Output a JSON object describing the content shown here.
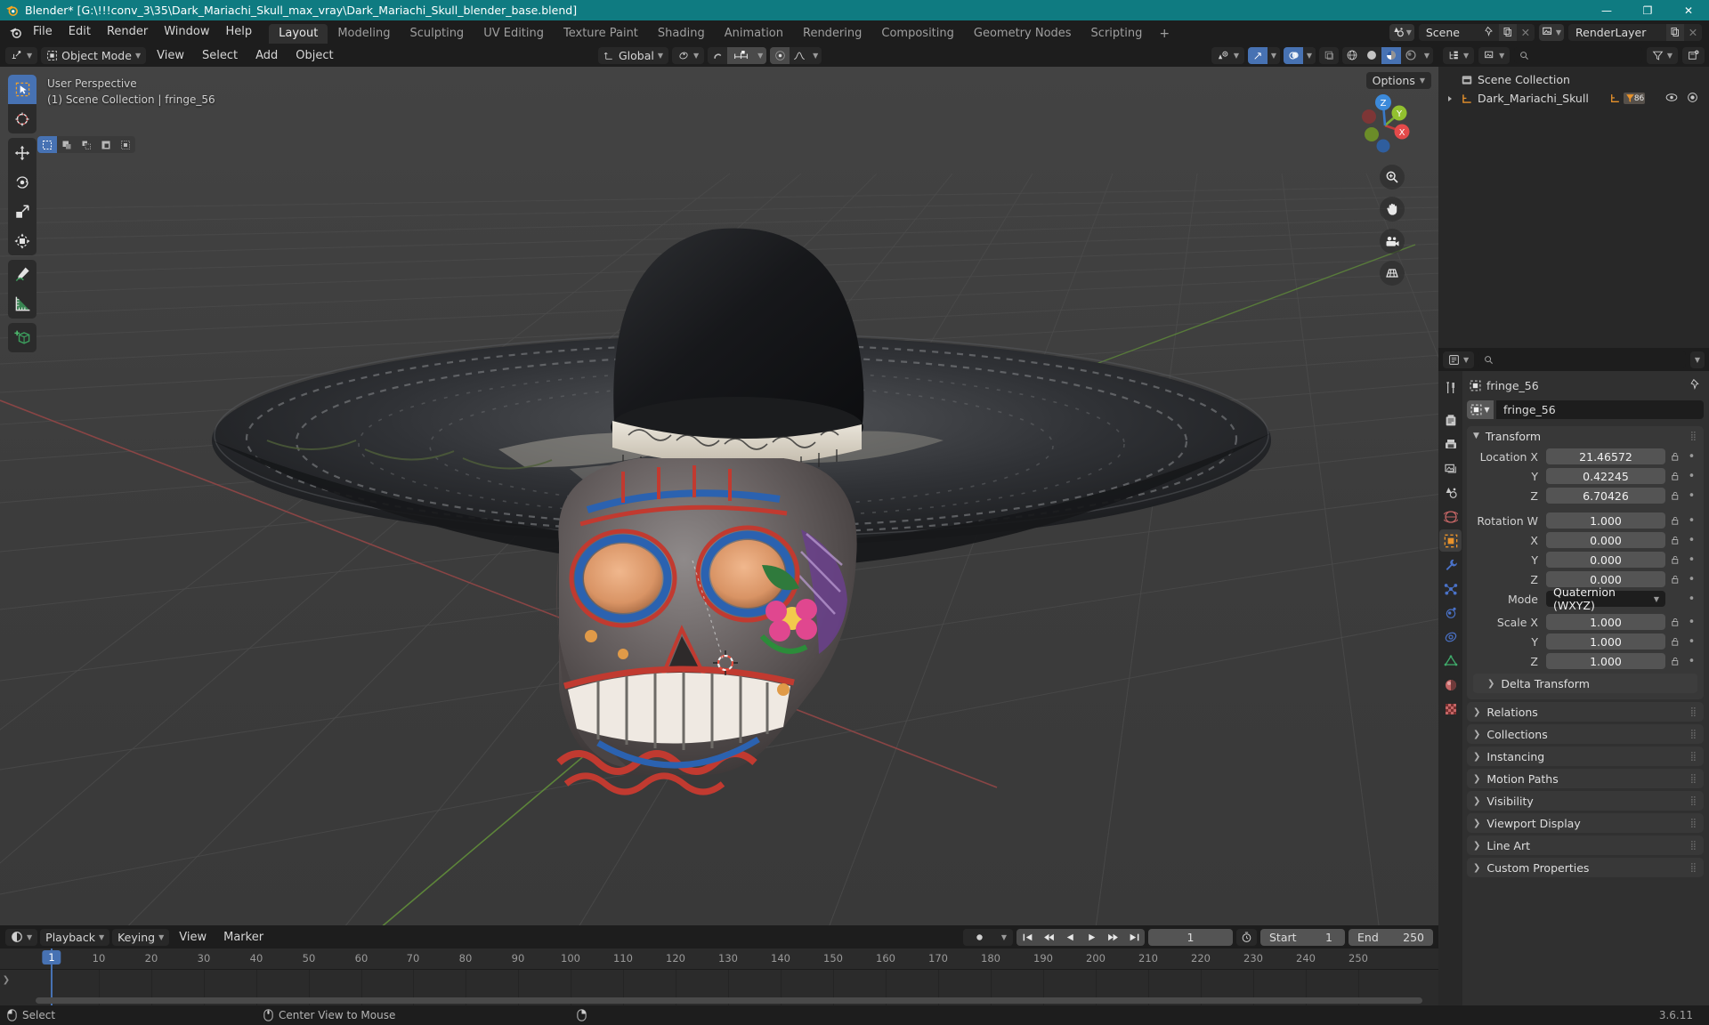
{
  "window": {
    "title": "Blender* [G:\\!!!conv_3\\35\\Dark_Mariachi_Skull_max_vray\\Dark_Mariachi_Skull_blender_base.blend]",
    "minimize": "—",
    "maximize": "❐",
    "close": "✕"
  },
  "topbar": {
    "menus": [
      "File",
      "Edit",
      "Render",
      "Window",
      "Help"
    ],
    "workspaces": [
      {
        "label": "Layout",
        "active": true
      },
      {
        "label": "Modeling",
        "active": false
      },
      {
        "label": "Sculpting",
        "active": false
      },
      {
        "label": "UV Editing",
        "active": false
      },
      {
        "label": "Texture Paint",
        "active": false
      },
      {
        "label": "Shading",
        "active": false
      },
      {
        "label": "Animation",
        "active": false
      },
      {
        "label": "Rendering",
        "active": false
      },
      {
        "label": "Compositing",
        "active": false
      },
      {
        "label": "Geometry Nodes",
        "active": false
      },
      {
        "label": "Scripting",
        "active": false
      }
    ],
    "add_workspace": "+",
    "scene_name": "Scene",
    "viewlayer_name": "RenderLayer"
  },
  "viewport_header": {
    "mode": "Object Mode",
    "menus": [
      "View",
      "Select",
      "Add",
      "Object"
    ],
    "transform_orientation": "Global",
    "options_label": "Options"
  },
  "viewport": {
    "perspective_text": "User Perspective",
    "collection_text": "(1) Scene Collection | fringe_56",
    "gizmo_axes": [
      "X",
      "Y",
      "Z"
    ],
    "tools": [
      "select-box-tool",
      "cursor-tool",
      "move-tool",
      "rotate-tool",
      "scale-tool",
      "transform-tool",
      "annotate-tool",
      "measure-tool",
      "add-cube-tool"
    ],
    "nav_buttons": [
      "zoom-icon",
      "pan-hand-icon",
      "camera-icon",
      "grid-ortho-icon"
    ]
  },
  "outliner": {
    "search_placeholder": "",
    "rows": [
      {
        "label": "Scene Collection",
        "level": 0,
        "icon": "collection-icon"
      },
      {
        "label": "Dark_Mariachi_Skull",
        "level": 1,
        "icon": "empty-axes-icon",
        "badge": "86"
      }
    ]
  },
  "properties": {
    "search_placeholder": "",
    "breadcrumb_object": "fringe_56",
    "object_name": "fringe_56",
    "tabs": [
      "tool-tab",
      "render-tab",
      "output-tab",
      "viewlayer-tab",
      "scene-tab",
      "world-tab",
      "object-tab",
      "modifier-tab",
      "particles-tab",
      "physics-tab",
      "constraints-tab",
      "data-tab",
      "material-tab",
      "texture-tab"
    ],
    "transform": {
      "title": "Transform",
      "location_label": "Location X",
      "location": [
        {
          "label": "Location X",
          "value": "21.46572"
        },
        {
          "label": "Y",
          "value": "0.42245"
        },
        {
          "label": "Z",
          "value": "6.70426"
        }
      ],
      "rotation": [
        {
          "label": "Rotation W",
          "value": "1.000"
        },
        {
          "label": "X",
          "value": "0.000"
        },
        {
          "label": "Y",
          "value": "0.000"
        },
        {
          "label": "Z",
          "value": "0.000"
        }
      ],
      "mode_label": "Mode",
      "mode_value": "Quaternion (WXYZ)",
      "scale": [
        {
          "label": "Scale X",
          "value": "1.000"
        },
        {
          "label": "Y",
          "value": "1.000"
        },
        {
          "label": "Z",
          "value": "1.000"
        }
      ],
      "delta_transform": "Delta Transform"
    },
    "panels": [
      "Relations",
      "Collections",
      "Instancing",
      "Motion Paths",
      "Visibility",
      "Viewport Display",
      "Line Art",
      "Custom Properties"
    ]
  },
  "timeline": {
    "menus": [
      "Playback",
      "Keying",
      "View",
      "Marker"
    ],
    "current_frame": "1",
    "start_label": "Start",
    "start_value": "1",
    "end_label": "End",
    "end_value": "250",
    "ticks": [
      "1",
      "10",
      "20",
      "30",
      "40",
      "50",
      "60",
      "70",
      "80",
      "90",
      "100",
      "110",
      "120",
      "130",
      "140",
      "150",
      "160",
      "170",
      "180",
      "190",
      "200",
      "210",
      "220",
      "230",
      "240",
      "250"
    ]
  },
  "statusbar": {
    "items": [
      {
        "icon": "mouse-left-icon",
        "label": "Select"
      },
      {
        "icon": "mouse-middle-icon",
        "label": "Center View to Mouse"
      },
      {
        "icon": "mouse-right-icon",
        "label": ""
      }
    ],
    "version": "3.6.11"
  },
  "colors": {
    "title_bar": "#0f7b81",
    "accent_blue": "#4772b3",
    "object_orange": "#e8922b",
    "axis_x": "#e04040",
    "axis_y": "#7fc13b",
    "axis_z": "#3b84d8"
  }
}
